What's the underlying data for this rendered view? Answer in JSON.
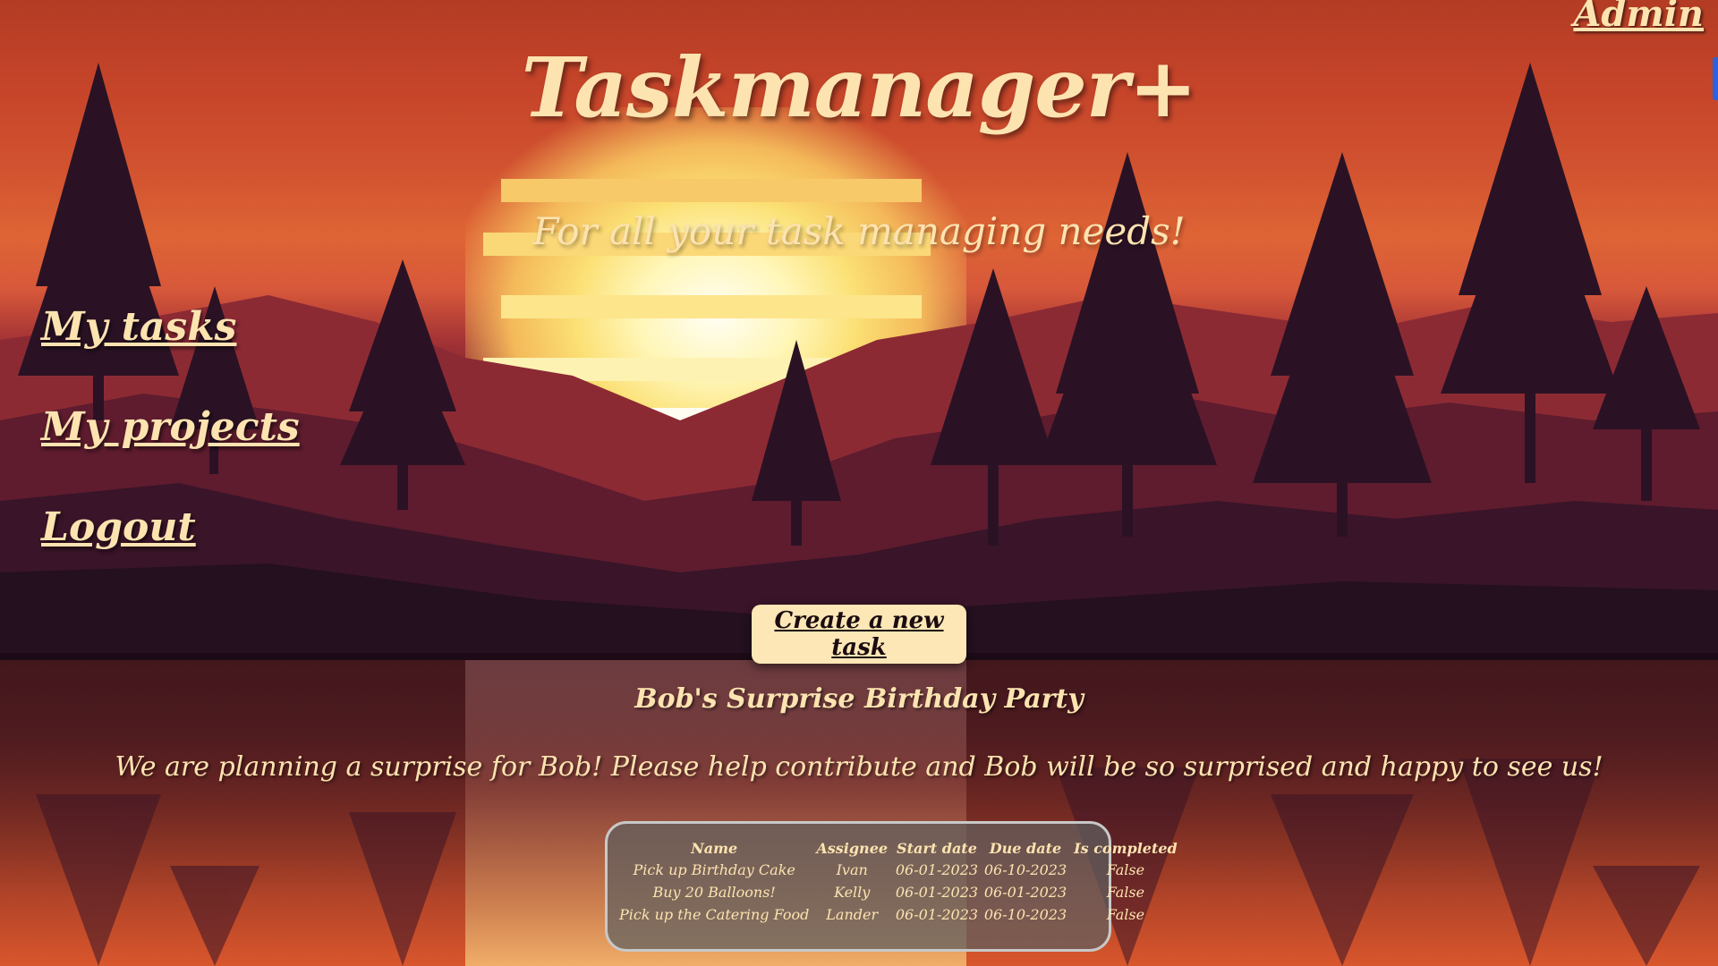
{
  "header": {
    "admin_label": "Admin",
    "app_title": "Taskmanager+",
    "tagline": "For all your task managing needs!"
  },
  "nav": {
    "items": [
      {
        "label": "My tasks"
      },
      {
        "label": "My projects"
      },
      {
        "label": "Logout"
      }
    ]
  },
  "actions": {
    "create_task_label": "Create a new task"
  },
  "project": {
    "name": "Bob's Surprise Birthday Party",
    "description": "We are planning a surprise for Bob! Please help contribute and Bob will be so surprised and happy to see us!"
  },
  "tasks": {
    "columns": [
      "Name",
      "Assignee",
      "Start date",
      "Due date",
      "Is completed"
    ],
    "rows": [
      [
        "Pick up Birthday Cake",
        "Ivan",
        "06-01-2023",
        "06-10-2023",
        "False"
      ],
      [
        "Buy 20 Balloons!",
        "Kelly",
        "06-01-2023",
        "06-01-2023",
        "False"
      ],
      [
        "Pick up the Catering Food",
        "Lander",
        "06-01-2023",
        "06-10-2023",
        "False"
      ]
    ]
  },
  "colors": {
    "accent_text": "#fde3b0",
    "button_bg": "#fde7b6",
    "sky_top": "#b33c24",
    "ground_dark": "#2b1024",
    "edge_tab": "#2a62e0"
  },
  "icons": {
    "background": "pixel-art-sunset-forest"
  }
}
